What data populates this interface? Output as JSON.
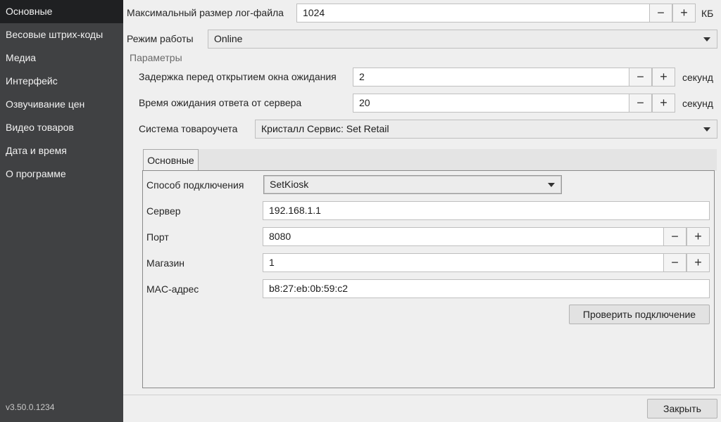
{
  "sidebar": {
    "items": [
      {
        "label": "Основные"
      },
      {
        "label": "Весовые штрих-коды"
      },
      {
        "label": "Медиа"
      },
      {
        "label": "Интерфейс"
      },
      {
        "label": "Озвучивание цен"
      },
      {
        "label": "Видео товаров"
      },
      {
        "label": "Дата и время"
      },
      {
        "label": "О программе"
      }
    ],
    "version": "v3.50.0.1234"
  },
  "general": {
    "log_size_label": "Максимальный размер лог-файла",
    "log_size_value": "1024",
    "log_size_unit": "КБ",
    "mode_label": "Режим работы",
    "mode_value": "Online",
    "params_header": "Параметры",
    "wait_delay_label": "Задержка перед открытием окна ожидания",
    "wait_delay_value": "2",
    "wait_delay_unit": "секунд",
    "server_timeout_label": "Время ожидания ответа от сервера",
    "server_timeout_value": "20",
    "server_timeout_unit": "секунд",
    "accounting_label": "Система товароучета",
    "accounting_value": "Кристалл Сервис: Set Retail"
  },
  "tabs": [
    {
      "label": "Основные"
    }
  ],
  "connection": {
    "method_label": "Способ подключения",
    "method_value": "SetKiosk",
    "server_label": "Сервер",
    "server_value": "192.168.1.1",
    "port_label": "Порт",
    "port_value": "8080",
    "store_label": "Магазин",
    "store_value": "1",
    "mac_label": "MAC-адрес",
    "mac_value": "b8:27:eb:0b:59:c2",
    "check_button": "Проверить подключение"
  },
  "controls": {
    "minus": "−",
    "plus": "+"
  },
  "footer": {
    "close_button": "Закрыть"
  }
}
